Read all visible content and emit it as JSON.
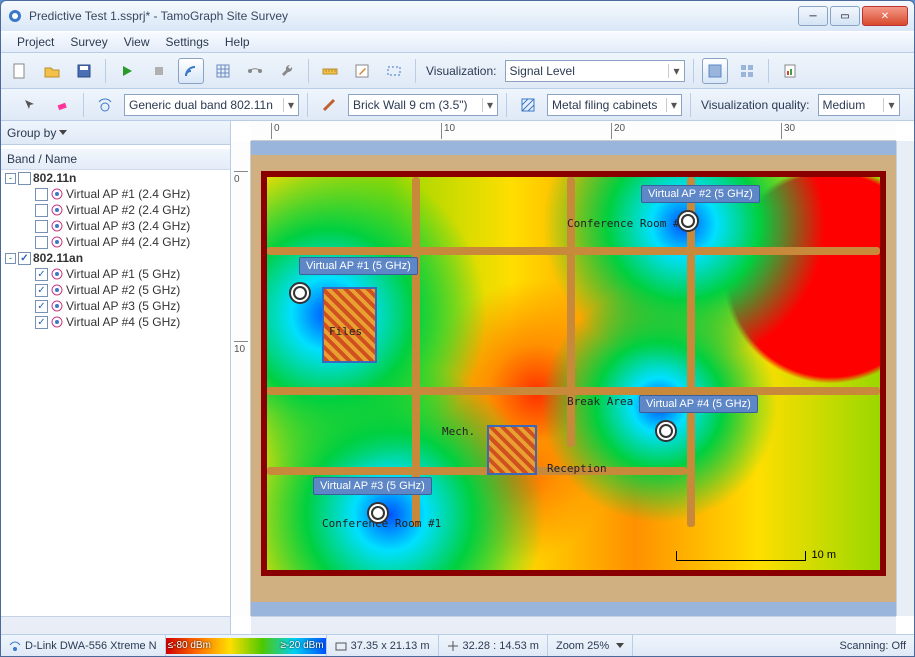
{
  "window": {
    "title": "Predictive Test 1.ssprj* - TamoGraph Site Survey"
  },
  "menu": {
    "items": [
      "Project",
      "Survey",
      "View",
      "Settings",
      "Help"
    ]
  },
  "toolbar": {
    "vis_label": "Visualization:",
    "vis_value": "Signal Level"
  },
  "toolbar2": {
    "ap_model": "Generic dual band 802.11n",
    "wall": "Brick Wall 9 cm (3.5\")",
    "atten": "Metal filing cabinets",
    "vq_label": "Visualization quality:",
    "vq_value": "Medium"
  },
  "sidebar": {
    "groupby": "Group by",
    "header": "Band / Name",
    "groups": [
      {
        "exp": "-",
        "checked": false,
        "label": "802.11n",
        "items": [
          {
            "checked": false,
            "label": "Virtual AP #1 (2.4 GHz)"
          },
          {
            "checked": false,
            "label": "Virtual AP #2 (2.4 GHz)"
          },
          {
            "checked": false,
            "label": "Virtual AP #3 (2.4 GHz)"
          },
          {
            "checked": false,
            "label": "Virtual AP #4 (2.4 GHz)"
          }
        ]
      },
      {
        "exp": "-",
        "checked": true,
        "label": "802.11an",
        "items": [
          {
            "checked": true,
            "label": "Virtual AP #1 (5 GHz)"
          },
          {
            "checked": true,
            "label": "Virtual AP #2 (5 GHz)"
          },
          {
            "checked": true,
            "label": "Virtual AP #3 (5 GHz)"
          },
          {
            "checked": true,
            "label": "Virtual AP #4 (5 GHz)"
          }
        ]
      }
    ]
  },
  "map": {
    "ruler_h": [
      "0",
      "10",
      "20",
      "30"
    ],
    "ruler_v": [
      "0",
      "10"
    ],
    "aps": [
      {
        "label": "Virtual AP #1 (5 GHz)"
      },
      {
        "label": "Virtual AP #2 (5 GHz)"
      },
      {
        "label": "Virtual AP #3 (5 GHz)"
      },
      {
        "label": "Virtual AP #4 (5 GHz)"
      }
    ],
    "rooms": {
      "conf2": "Conference Room #2",
      "conf1": "Conference Room #1",
      "break": "Break Area",
      "mech": "Mech.",
      "reception": "Reception",
      "files": "Files"
    },
    "scale_label": "10 m"
  },
  "status": {
    "adapter": "D-Link DWA-556 Xtreme N",
    "leg_lo": "≤-80 dBm",
    "leg_hi": "≥-20 dBm",
    "size": "37.35 x 21.13 m",
    "cursor": "32.28 : 14.53 m",
    "zoom_label": "Zoom 25%",
    "scan": "Scanning: Off"
  }
}
